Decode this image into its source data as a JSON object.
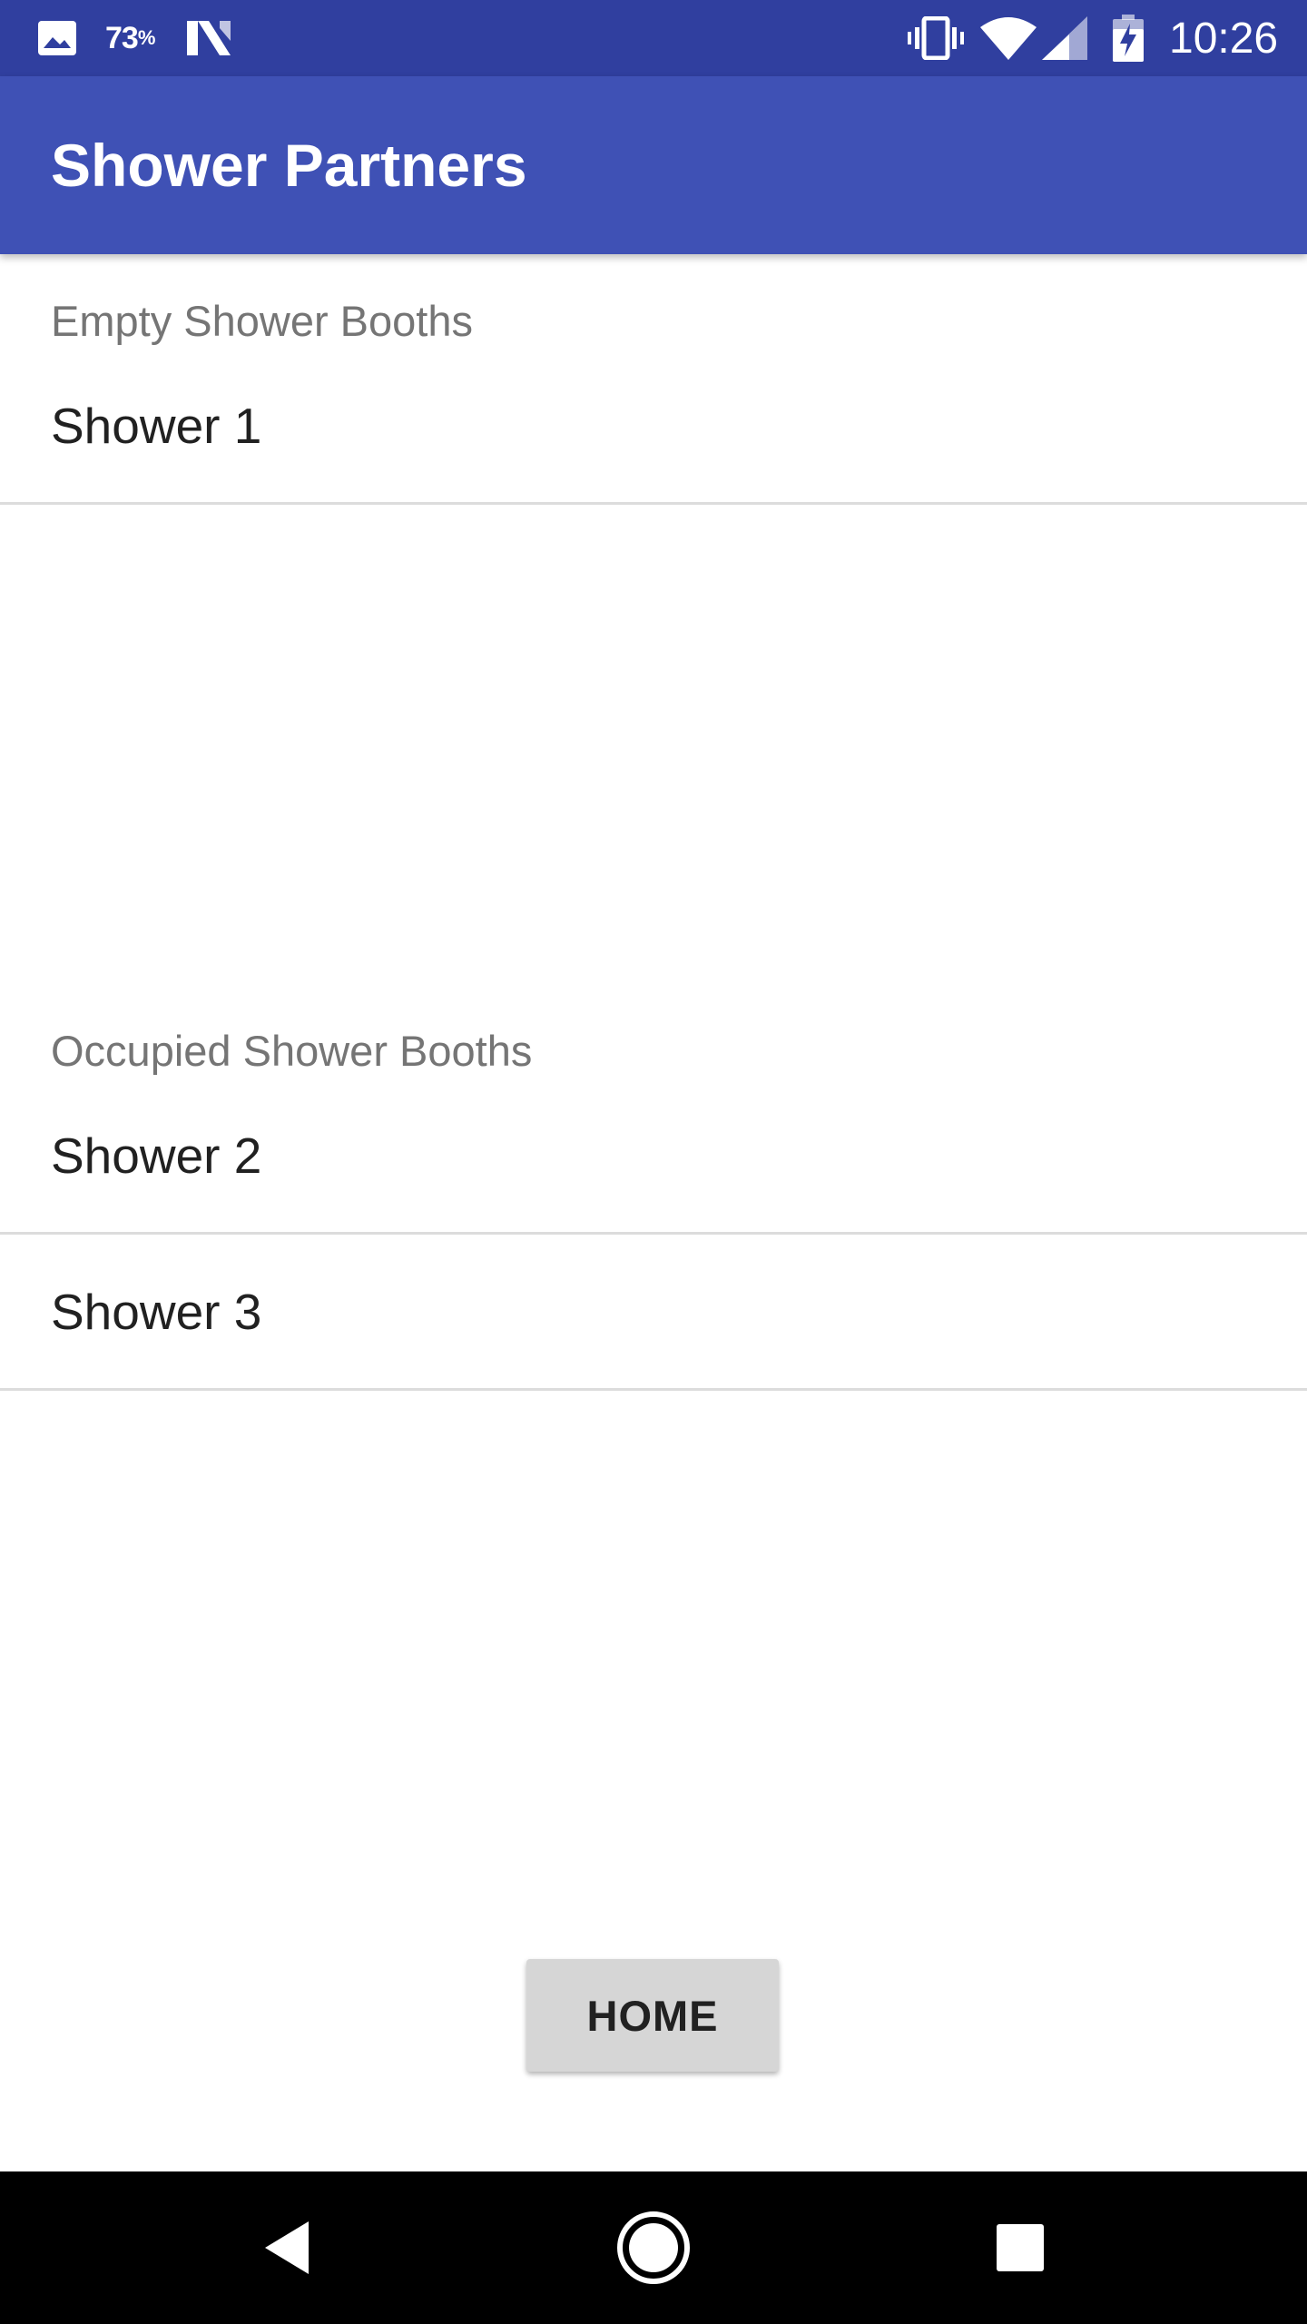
{
  "colors": {
    "status_bar": "#303f9f",
    "primary": "#3f51b5"
  },
  "status_bar": {
    "battery_percent": "73",
    "battery_percent_sign": "%",
    "time": "10:26",
    "icons": [
      "gallery-icon",
      "n-logo-icon",
      "vibrate-icon",
      "wifi-icon",
      "cell-signal-icon",
      "battery-charging-icon"
    ]
  },
  "app_bar": {
    "title": "Shower Partners"
  },
  "sections": {
    "empty": {
      "header": "Empty Shower Booths",
      "items": [
        "Shower 1"
      ]
    },
    "occupied": {
      "header": "Occupied Shower Booths",
      "items": [
        "Shower 2",
        "Shower 3"
      ]
    }
  },
  "home_button": {
    "label": "HOME"
  },
  "nav_bar": {
    "icons": [
      "back-icon",
      "home-circle-icon",
      "recents-icon"
    ]
  }
}
